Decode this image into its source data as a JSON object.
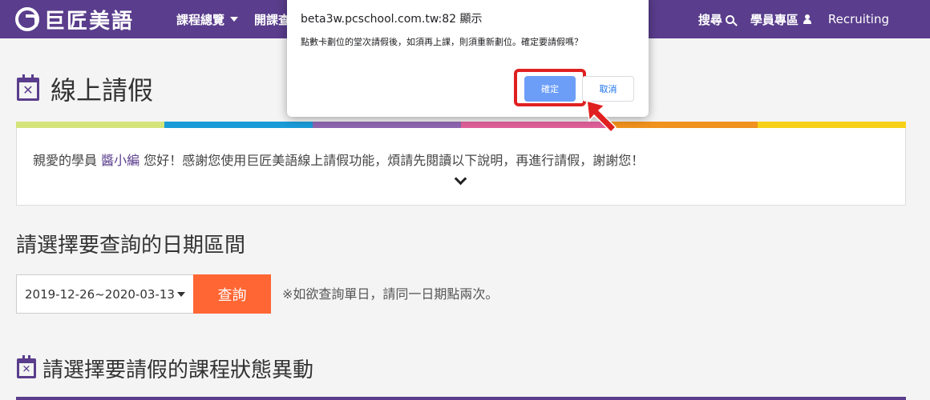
{
  "brand": {
    "logo_text": "巨匠美語"
  },
  "nav": {
    "left": [
      {
        "label": "課程總覽"
      },
      {
        "label": "開課查"
      }
    ],
    "right": [
      {
        "label": "搜尋"
      },
      {
        "label": "學員專區"
      },
      {
        "label": "Recruiting"
      }
    ]
  },
  "page": {
    "title": "線上請假"
  },
  "info": {
    "prefix": "親愛的學員 ",
    "name": "醬小編",
    "suffix": " 您好！感謝您使用巨匠美語線上請假功能，煩請先閱讀以下說明，再進行請假，謝謝您！",
    "colors": [
      "#d4e37a",
      "#1a9bd7",
      "#8e66b0",
      "#e0609a",
      "#f0921e",
      "#f7d117"
    ]
  },
  "query": {
    "section_title": "請選擇要查詢的日期區間",
    "date_range": "2019-12-26~2020-03-13",
    "button_label": "查詢",
    "hint": "※如欲查詢單日，請同一日期點兩次。"
  },
  "section2": {
    "title": "請選擇要請假的課程狀態異動"
  },
  "dialog": {
    "host": "beta3w.pcschool.com.tw:82 顯示",
    "message": "點數卡劃位的堂次請假後，如須再上課，則須重新劃位。確定要請假嗎？",
    "ok_label": "確定",
    "cancel_label": "取消"
  },
  "colors": {
    "nav_bg": "#5a3d8c",
    "accent_orange": "#ff6633",
    "highlight_red": "#e02020"
  }
}
